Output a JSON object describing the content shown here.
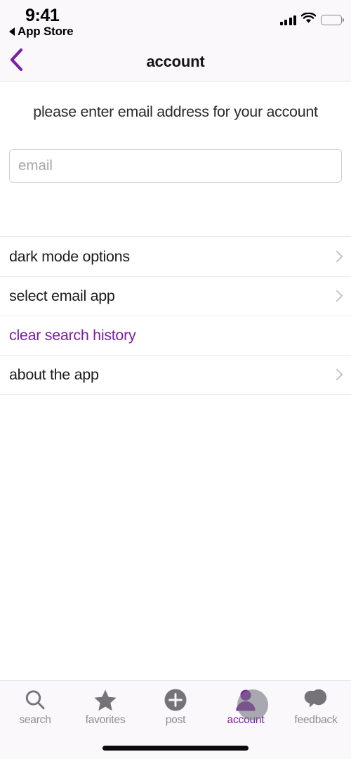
{
  "status_bar": {
    "time": "9:41",
    "back_app_label": "App Store",
    "back_triangle_icon": "triangle-left-icon",
    "signal_icon": "cellular-signal-icon",
    "wifi_icon": "wifi-icon",
    "battery_icon": "battery-full-icon"
  },
  "nav_bar": {
    "back_icon": "chevron-left-icon",
    "title": "account",
    "accent_color": "#7b1fa2",
    "background_color": "#faf8fb"
  },
  "content": {
    "prompt": "please enter email address for your account",
    "email_input": {
      "value": "",
      "placeholder": "email"
    }
  },
  "settings": {
    "rows": [
      {
        "label": "dark mode options",
        "chevron": "chevron-right-icon",
        "destructive": false
      },
      {
        "label": "select email app",
        "chevron": "chevron-right-icon",
        "destructive": false
      },
      {
        "label": "clear search history",
        "chevron": "",
        "destructive": true
      },
      {
        "label": "about the app",
        "chevron": "chevron-right-icon",
        "destructive": false
      }
    ]
  },
  "tab_bar": {
    "active_index": 3,
    "inactive_color": "#8e8c94",
    "active_color": "#7b1fa2",
    "items": [
      {
        "label": "search",
        "icon": "search-icon"
      },
      {
        "label": "favorites",
        "icon": "star-icon"
      },
      {
        "label": "post",
        "icon": "plus-circle-icon"
      },
      {
        "label": "account",
        "icon": "person-icon"
      },
      {
        "label": "feedback",
        "icon": "speech-bubbles-icon"
      }
    ]
  },
  "home_indicator": "home-indicator-bar"
}
